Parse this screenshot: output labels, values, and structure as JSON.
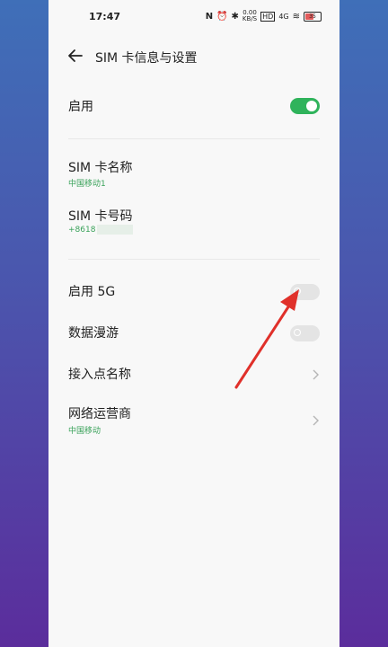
{
  "status_bar": {
    "time": "17:47",
    "speed_value": "0.00",
    "speed_unit": "KB/S",
    "network": "4G",
    "battery": "35"
  },
  "header": {
    "title": "SIM 卡信息与设置"
  },
  "settings": {
    "enable_label": "启用",
    "enable_on": true,
    "sim_name_label": "SIM 卡名称",
    "sim_name_value": "中国移动1",
    "sim_number_label": "SIM 卡号码",
    "sim_number_value": "+8618",
    "enable5g_label": "启用 5G",
    "enable5g_on": false,
    "roaming_label": "数据漫游",
    "roaming_on": false,
    "apn_label": "接入点名称",
    "operator_label": "网络运营商",
    "operator_value": "中国移动"
  },
  "colors": {
    "toggle_on": "#2fb35b",
    "toggle_off": "#e4e4e4",
    "subtext_green": "#3aa25a",
    "annotation_arrow": "#e0302a"
  }
}
